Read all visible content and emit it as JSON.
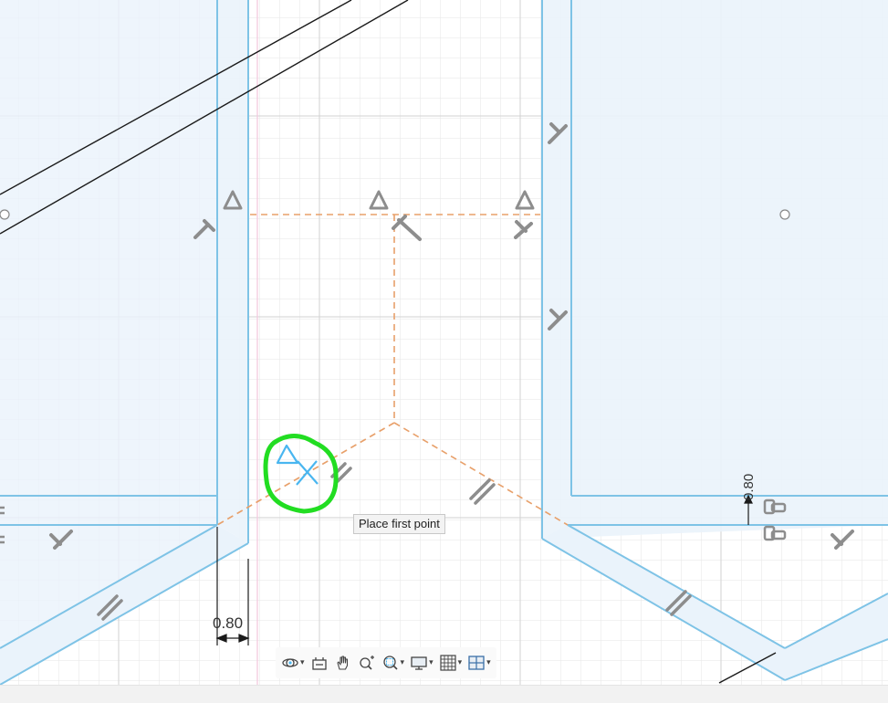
{
  "canvas": {
    "tooltip_text": "Place first point",
    "dimension_horizontal": "0.80",
    "dimension_vertical": "0.80"
  },
  "colors": {
    "grid_minor": "#e6e6e6",
    "grid_major": "#cfcfcf",
    "profile_fill": "#eaf3fb",
    "profile_edge": "#7ec3e6",
    "construction_line": "#e8a06a",
    "sketch_line": "#1a1a1a",
    "highlight": "#22dd22",
    "cursor_icon": "#49b6f0",
    "constraint_glyph": "#8d8d8d"
  },
  "toolbar": {
    "items": [
      {
        "name": "orbit-icon",
        "has_menu": true
      },
      {
        "name": "look-at-icon",
        "has_menu": false
      },
      {
        "name": "pan-icon",
        "has_menu": false
      },
      {
        "name": "zoom-icon",
        "has_menu": false
      },
      {
        "name": "fit-icon",
        "has_menu": true
      },
      {
        "name": "display-settings-icon",
        "has_menu": true
      },
      {
        "name": "grid-snaps-icon",
        "has_menu": true
      },
      {
        "name": "viewports-icon",
        "has_menu": true
      }
    ]
  }
}
